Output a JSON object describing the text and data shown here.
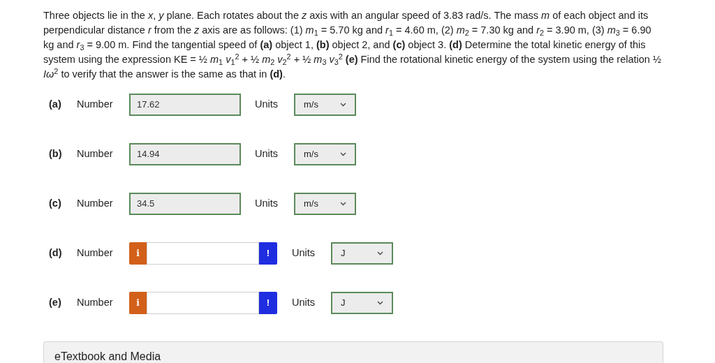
{
  "question": "Three objects lie in the *x*, *y* plane. Each rotates about the *z* axis with an angular speed of 3.83 rad/s. The mass *m* of each object and its perpendicular distance *r* from the *z* axis are as follows: (1) *m*$_{1}$ = 5.70 kg and *r*$_{1}$ = 4.60 m, (2) *m*$_{2}$ = 7.30 kg and *r*$_{2}$ = 3.90 m, (3) *m*$_{3}$ = 6.90 kg and *r*$_{3}$ = 9.00 m. Find the tangential speed of **(a)** object 1, **(b)** object 2, and **(c)** object 3. **(d)** Determine the total kinetic energy of this system using the expression KE = ½ *m*$_{1}$ *v*$_{1}$$^{2}$ + ½ *m*$_{2}$ *v*$_{2}$$^{2}$ + ½ *m*$_{3}$ *v*$_{3}$$^{2}$ **(e)** Find the rotational kinetic energy of the system using the relation ½ *Iω*$^{2}$ to verify that the answer is the same as that in **(d)**.",
  "parts": [
    {
      "label": "(a)",
      "number_label": "Number",
      "answered": true,
      "value": "17.62",
      "units_label": "Units",
      "unit": "m/s"
    },
    {
      "label": "(b)",
      "number_label": "Number",
      "answered": true,
      "value": "14.94",
      "units_label": "Units",
      "unit": "m/s"
    },
    {
      "label": "(c)",
      "number_label": "Number",
      "answered": true,
      "value": "34.5",
      "units_label": "Units",
      "unit": "m/s"
    },
    {
      "label": "(d)",
      "number_label": "Number",
      "answered": false,
      "info_badge": "i",
      "alert_badge": "!",
      "units_label": "Units",
      "unit": "J"
    },
    {
      "label": "(e)",
      "number_label": "Number",
      "answered": false,
      "info_badge": "i",
      "alert_badge": "!",
      "units_label": "Units",
      "unit": "J"
    }
  ],
  "footer": {
    "title": "eTextbook and Media"
  }
}
